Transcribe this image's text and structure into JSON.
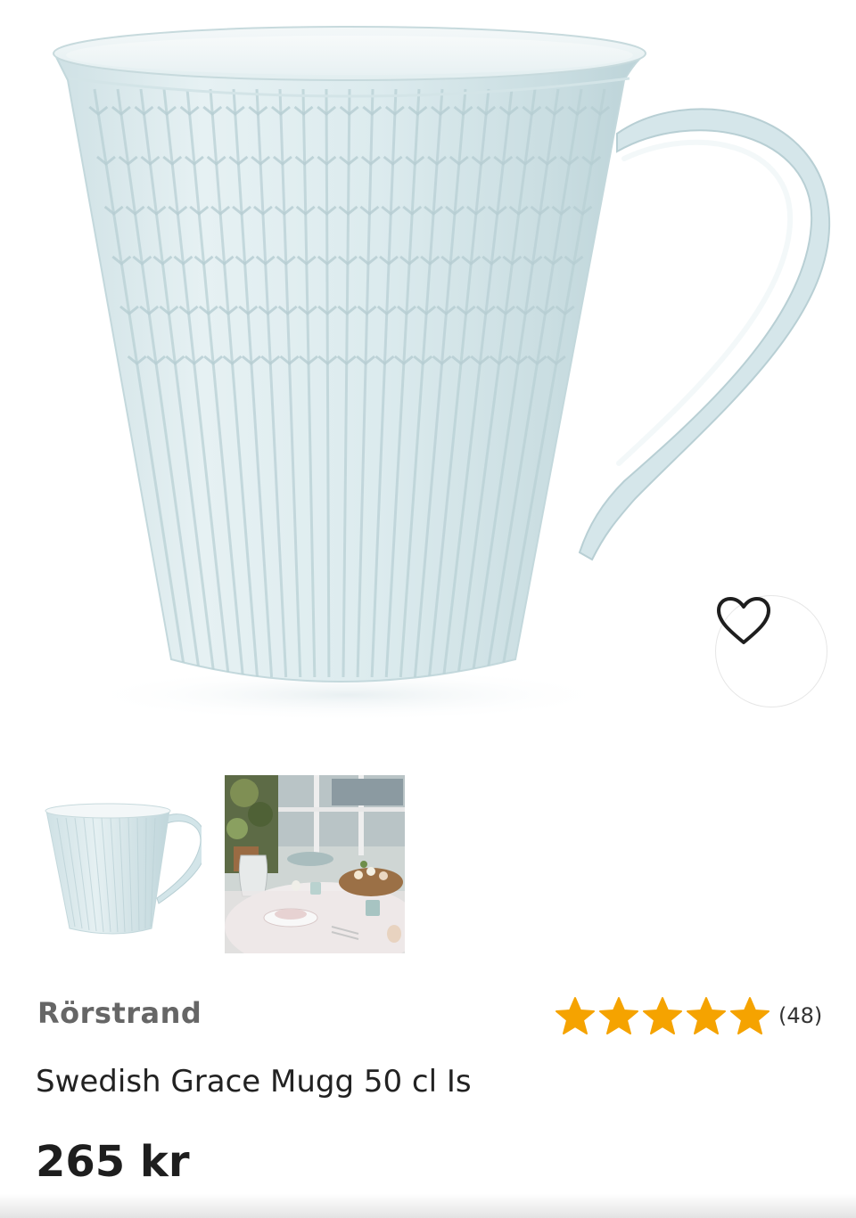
{
  "product": {
    "brand": "Rörstrand",
    "name": "Swedish Grace Mugg 50 cl Is",
    "price": "265 kr",
    "rating": {
      "stars": 5,
      "max_stars": 5,
      "review_count": "(48)"
    },
    "color_name": "Is",
    "mug_color": "#d8e8ec",
    "accent_star_color": "#f5a300"
  },
  "gallery": {
    "main_image": "mug-product-photo",
    "thumbnails": [
      {
        "kind": "mug-product-photo"
      },
      {
        "kind": "table-setting-photo"
      }
    ]
  },
  "actions": {
    "favorite_icon": "heart-outline-icon"
  }
}
